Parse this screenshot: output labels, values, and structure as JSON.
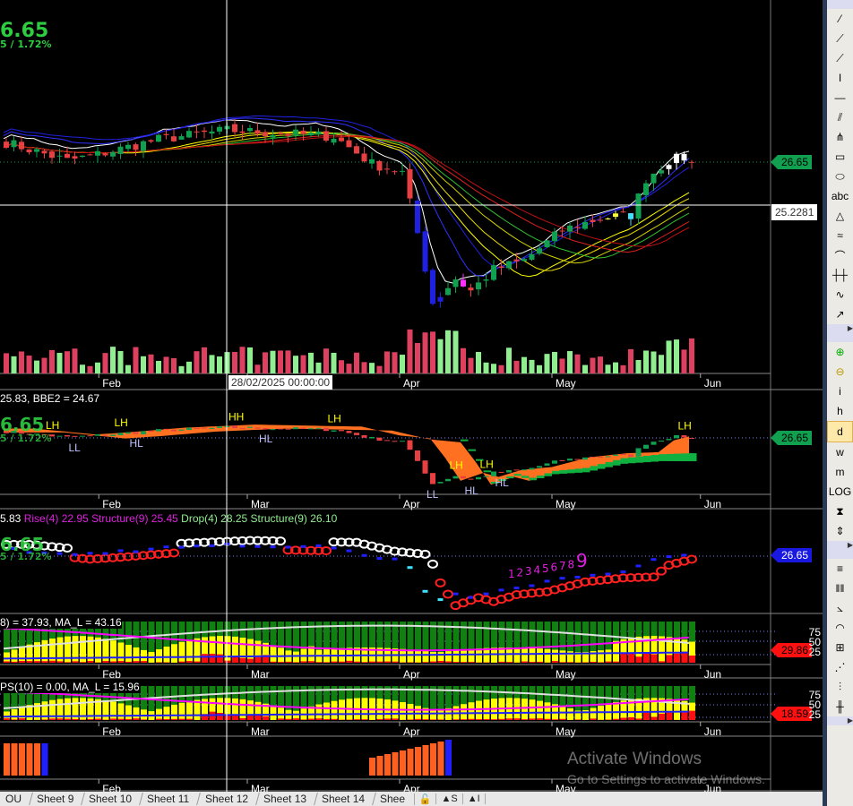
{
  "header": {
    "last_price": "6.65",
    "change": "5 / 1.72%"
  },
  "crosshair": {
    "date_label": "28/02/2025 00:00:00",
    "price_label": "25.2281"
  },
  "x_axis": [
    "Feb",
    "Mar",
    "Apr",
    "May",
    "Jun"
  ],
  "panels": {
    "price": {
      "last_tag": "26.65"
    },
    "bbe": {
      "legend": "25.83, BBE2 = 24.67",
      "last_tag": "26.65",
      "big_price": "6.65",
      "big_change": "5 / 1.72%",
      "annotations": [
        {
          "text": "LH",
          "i": 6
        },
        {
          "text": "LL",
          "i": 9
        },
        {
          "text": "LH",
          "i": 15
        },
        {
          "text": "HL",
          "i": 17
        },
        {
          "text": "HH",
          "i": 30
        },
        {
          "text": "HL",
          "i": 34
        },
        {
          "text": "LH",
          "i": 43
        },
        {
          "text": "LL",
          "i": 56
        },
        {
          "text": "LH",
          "i": 59
        },
        {
          "text": "HL",
          "i": 61
        },
        {
          "text": "LH",
          "i": 63
        },
        {
          "text": "HL",
          "i": 65
        },
        {
          "text": "LH",
          "i": 89
        }
      ]
    },
    "structure": {
      "legend_prefix": "5.83",
      "rise": "Rise(4) 22.95",
      "rise_struct": "Structure(9) 25.45",
      "drop": "Drop(4) 28.25",
      "drop_struct": "Structure(9) 26.10",
      "last_tag": "26.65",
      "big_price": "6.65",
      "big_change": "5 / 1.72%",
      "count_labels": [
        "1",
        "2",
        "3",
        "4",
        "5",
        "6",
        "7",
        "8",
        "9"
      ]
    },
    "osc1": {
      "legend": "8) = 37.93, MA_L = 43.16",
      "levels": [
        "75",
        "50",
        "25"
      ],
      "last_tag": "29.86"
    },
    "osc2": {
      "legend": "PS(10) = 0.00, MA_L = 15.96",
      "levels": [
        "75",
        "50",
        "25"
      ],
      "last_tag": "18.59"
    }
  },
  "tabs": [
    "OU",
    "Sheet 9",
    "Sheet 10",
    "Sheet 11",
    "Sheet 12",
    "Sheet 13",
    "Sheet 14",
    "Shee"
  ],
  "tab_buttons": {
    "lock": "🔓",
    "s": "▲S",
    "i": "▲I"
  },
  "toolbar": {
    "group1": [
      "line-segment",
      "ray",
      "extended-line",
      "vertical-segment",
      "horizontal-line",
      "parallel-channel",
      "pitchfork",
      "rectangle",
      "ellipse",
      "abc",
      "triangle",
      "fibonacci",
      "arc",
      "time-cycles",
      "polyline",
      "arrow"
    ],
    "text_tool": "abc",
    "group2": [
      "zoom-in",
      "zoom-out",
      "i",
      "h",
      "d",
      "w",
      "m",
      "LOG",
      "fit",
      "scale"
    ],
    "group3": [
      "fib-retracement",
      "fib-timezones",
      "fan",
      "arcs",
      "grid",
      "speed-lines",
      "andrews",
      "cycle-lines"
    ],
    "expand": "▶"
  },
  "watermark": {
    "title": "Activate Windows",
    "subtitle": "Go to Settings to activate Windows."
  },
  "colors": {
    "up": "#10a050",
    "down": "#e84040",
    "accent_green": "#2ecc40",
    "magenta": "#ff00ff"
  },
  "chart_data": {
    "type": "candlestick",
    "price_keypoints": [
      [
        0,
        27.3
      ],
      [
        8,
        26.7
      ],
      [
        12,
        26.9
      ],
      [
        20,
        27.4
      ],
      [
        29,
        27.7
      ],
      [
        36,
        27.6
      ],
      [
        43,
        27.5
      ],
      [
        48,
        26.6
      ],
      [
        52,
        26.3
      ],
      [
        54,
        24.3
      ],
      [
        56,
        22.0
      ],
      [
        59,
        22.8
      ],
      [
        61,
        22.4
      ],
      [
        64,
        23.1
      ],
      [
        68,
        23.4
      ],
      [
        73,
        24.4
      ],
      [
        78,
        24.8
      ],
      [
        82,
        24.9
      ],
      [
        84,
        26.1
      ],
      [
        87,
        26.7
      ],
      [
        89,
        26.8
      ],
      [
        90,
        26.65
      ]
    ],
    "months": [
      {
        "label": "Feb",
        "i": 12.5
      },
      {
        "label": "Mar",
        "i": 32
      },
      {
        "label": "Apr",
        "i": 52
      },
      {
        "label": "May",
        "i": 72
      },
      {
        "label": "Jun",
        "i": 91.5
      }
    ]
  }
}
